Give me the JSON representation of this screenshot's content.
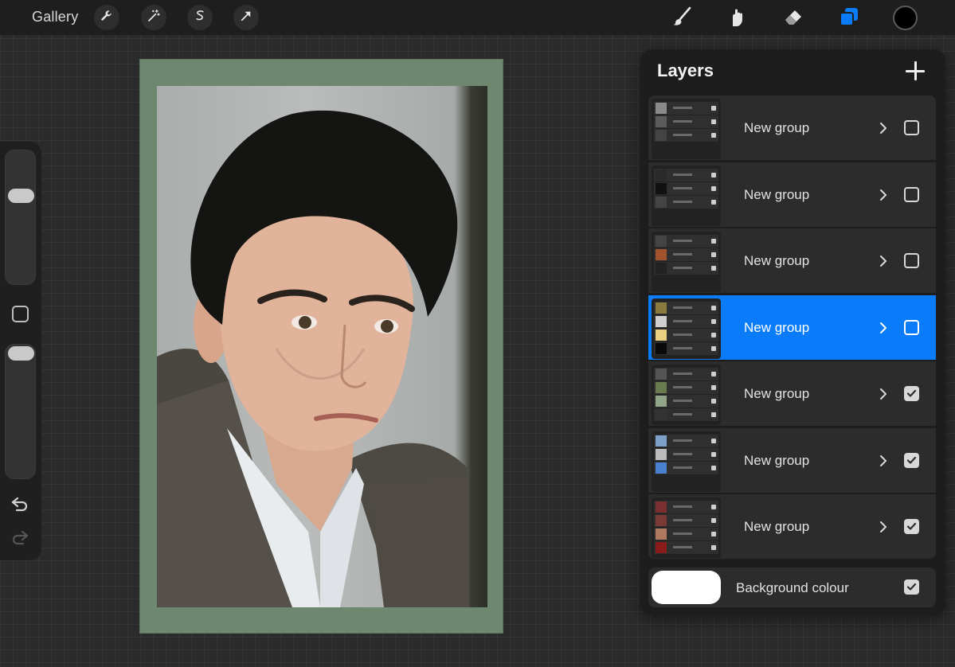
{
  "toolbar": {
    "gallery_label": "Gallery",
    "left_tools": [
      "wrench-icon",
      "magic-wand-icon",
      "selection-icon",
      "transform-arrow-icon"
    ],
    "right_tools": [
      "brush-icon",
      "smudge-icon",
      "eraser-icon",
      "layers-icon"
    ],
    "active_tool": "layers-icon",
    "current_color": "#000000",
    "accent_color": "#0a7cfa"
  },
  "sidebar": {
    "brush_size_level": 0.88,
    "opacity_level": 0.95,
    "controls": [
      "modify-button",
      "undo-icon",
      "redo-icon"
    ]
  },
  "canvas": {
    "frame_color": "#6e8870"
  },
  "layers_panel": {
    "title": "Layers",
    "add_icon": "plus-icon",
    "groups": [
      {
        "name": "New group",
        "selected": false,
        "visible": false
      },
      {
        "name": "New group",
        "selected": false,
        "visible": false
      },
      {
        "name": "New group",
        "selected": false,
        "visible": false
      },
      {
        "name": "New group",
        "selected": true,
        "visible": false
      },
      {
        "name": "New group",
        "selected": false,
        "visible": true
      },
      {
        "name": "New group",
        "selected": false,
        "visible": true
      },
      {
        "name": "New group",
        "selected": false,
        "visible": true
      }
    ],
    "background": {
      "label": "Background colour",
      "color": "#ffffff",
      "visible": true
    }
  }
}
